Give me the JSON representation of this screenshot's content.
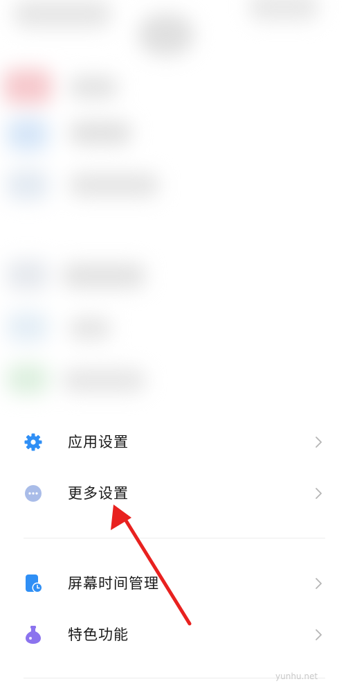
{
  "settings_list": {
    "items": [
      {
        "label": "应用设置",
        "icon": "gear-icon",
        "icon_color": "#2f8ff5"
      },
      {
        "label": "更多设置",
        "icon": "more-dots-icon",
        "icon_color": "#9fb4e6"
      },
      {
        "label": "屏幕时间管理",
        "icon": "screen-time-icon",
        "icon_color": "#2f8ff5"
      },
      {
        "label": "特色功能",
        "icon": "flask-icon",
        "icon_color": "#8b73ee"
      }
    ]
  },
  "annotation": {
    "arrow_color": "#e8211f"
  },
  "watermark": "yunhu.net"
}
